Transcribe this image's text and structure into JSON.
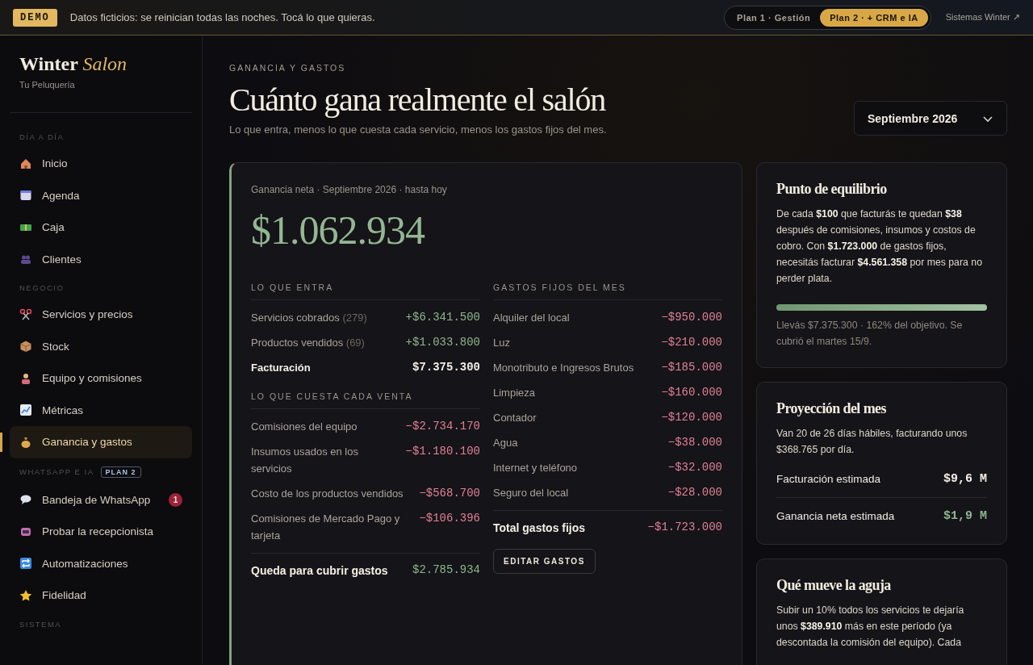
{
  "demo_bar": {
    "badge": "DEMO",
    "message": "Datos ficticios: se reinician todas las noches. Tocá lo que quieras.",
    "plans": [
      {
        "label": "Plan 1 · Gestión",
        "selected": false
      },
      {
        "label": "Plan 2 · + CRM e IA",
        "selected": true
      }
    ],
    "link": "Sistemas Winter ↗"
  },
  "sidebar": {
    "brand": {
      "name": "Winter",
      "accent": "Salon",
      "subtitle": "Tu Peluquería"
    },
    "sections": [
      {
        "label": "DÍA A DÍA",
        "items": [
          {
            "label": "Inicio",
            "selected": false
          },
          {
            "label": "Agenda",
            "selected": false
          },
          {
            "label": "Caja",
            "selected": false
          },
          {
            "label": "Clientes",
            "selected": false
          }
        ]
      },
      {
        "label": "NEGOCIO",
        "items": [
          {
            "label": "Servicios y precios",
            "selected": false
          },
          {
            "label": "Stock",
            "selected": false
          },
          {
            "label": "Equipo y comisiones",
            "selected": false
          },
          {
            "label": "Métricas",
            "selected": false
          },
          {
            "label": "Ganancia y gastos",
            "selected": true
          }
        ]
      },
      {
        "label": "WHATSAPP E IA",
        "badge": "PLAN 2",
        "items": [
          {
            "label": "Bandeja de WhatsApp",
            "selected": false,
            "count": "1"
          },
          {
            "label": "Probar la recepcionista",
            "selected": false
          },
          {
            "label": "Automatizaciones",
            "selected": false
          },
          {
            "label": "Fidelidad",
            "selected": false
          }
        ]
      },
      {
        "label": "SISTEMA"
      }
    ]
  },
  "header": {
    "eyebrow": "GANANCIA Y GASTOS",
    "title": "Cuánto gana realmente el salón",
    "subtitle": "Lo que entra, menos lo que cuesta cada servicio, menos los gastos fijos del mes.",
    "month": "Septiembre 2026"
  },
  "net_card": {
    "caption": "Ganancia neta · Septiembre 2026 · hasta hoy",
    "amount": "$1.062.934",
    "left_groups": [
      {
        "title": "LO QUE ENTRA",
        "rows": [
          {
            "label": "Servicios cobrados",
            "count": "(279)",
            "value": "+$6.341.500",
            "kind": "income"
          },
          {
            "label": "Productos vendidos",
            "count": "(69)",
            "value": "+$1.033.800",
            "kind": "income"
          },
          {
            "label": "Facturación",
            "value": "$7.375.300",
            "kind": "total"
          }
        ]
      },
      {
        "title": "LO QUE CUESTA CADA VENTA",
        "rows": [
          {
            "label": "Comisiones del equipo",
            "value": "−$2.734.170",
            "kind": "cost"
          },
          {
            "label": "Insumos usados en los servicios",
            "value": "−$1.180.100",
            "kind": "cost"
          },
          {
            "label": "Costo de los productos vendidos",
            "value": "−$568.700",
            "kind": "cost"
          },
          {
            "label": "Comisiones de Mercado Pago y tarjeta",
            "value": "−$106.396",
            "kind": "cost"
          }
        ],
        "total": {
          "label": "Queda para cubrir gastos",
          "value": "$2.785.934",
          "kind": "income"
        }
      }
    ],
    "fixed": {
      "title": "GASTOS FIJOS DEL MES",
      "rows": [
        {
          "label": "Alquiler del local",
          "value": "−$950.000",
          "kind": "cost"
        },
        {
          "label": "Luz",
          "value": "−$210.000",
          "kind": "cost"
        },
        {
          "label": "Monotributo e Ingresos Brutos",
          "value": "−$185.000",
          "kind": "cost"
        },
        {
          "label": "Limpieza",
          "value": "−$160.000",
          "kind": "cost"
        },
        {
          "label": "Contador",
          "value": "−$120.000",
          "kind": "cost"
        },
        {
          "label": "Agua",
          "value": "−$38.000",
          "kind": "cost"
        },
        {
          "label": "Internet y teléfono",
          "value": "−$32.000",
          "kind": "cost"
        },
        {
          "label": "Seguro del local",
          "value": "−$28.000",
          "kind": "cost"
        }
      ],
      "total": {
        "label": "Total gastos fijos",
        "value": "−$1.723.000",
        "kind": "cost"
      },
      "button": "EDITAR GASTOS"
    }
  },
  "breakeven": {
    "title": "Punto de equilibrio",
    "text": "De cada **$100** que facturás te quedan **$38** después de comisiones, insumos y costos de cobro. Con **$1.723.000** de gastos fijos, necesitás facturar **$4.561.358** por mes para no perder plata.",
    "level": 1,
    "note": "Llevás $7.375.300 · 162% del objetivo. Se cubrió el martes 15/9."
  },
  "projection": {
    "title": "Proyección del mes",
    "text": "Van 20 de 26 días hábiles, facturando unos $368.765 por día.",
    "rows": [
      {
        "label": "Facturación estimada",
        "value": "$9,6 M",
        "kind": "total"
      },
      {
        "label": "Ganancia neta estimada",
        "value": "$1,9 M",
        "kind": "income"
      }
    ]
  },
  "levers": {
    "title": "Qué mueve la aguja",
    "text": "Subir un 10% todos los servicios te dejaría unos **$389.910** más en este período (ya descontada la comisión del equipo). Cada"
  }
}
